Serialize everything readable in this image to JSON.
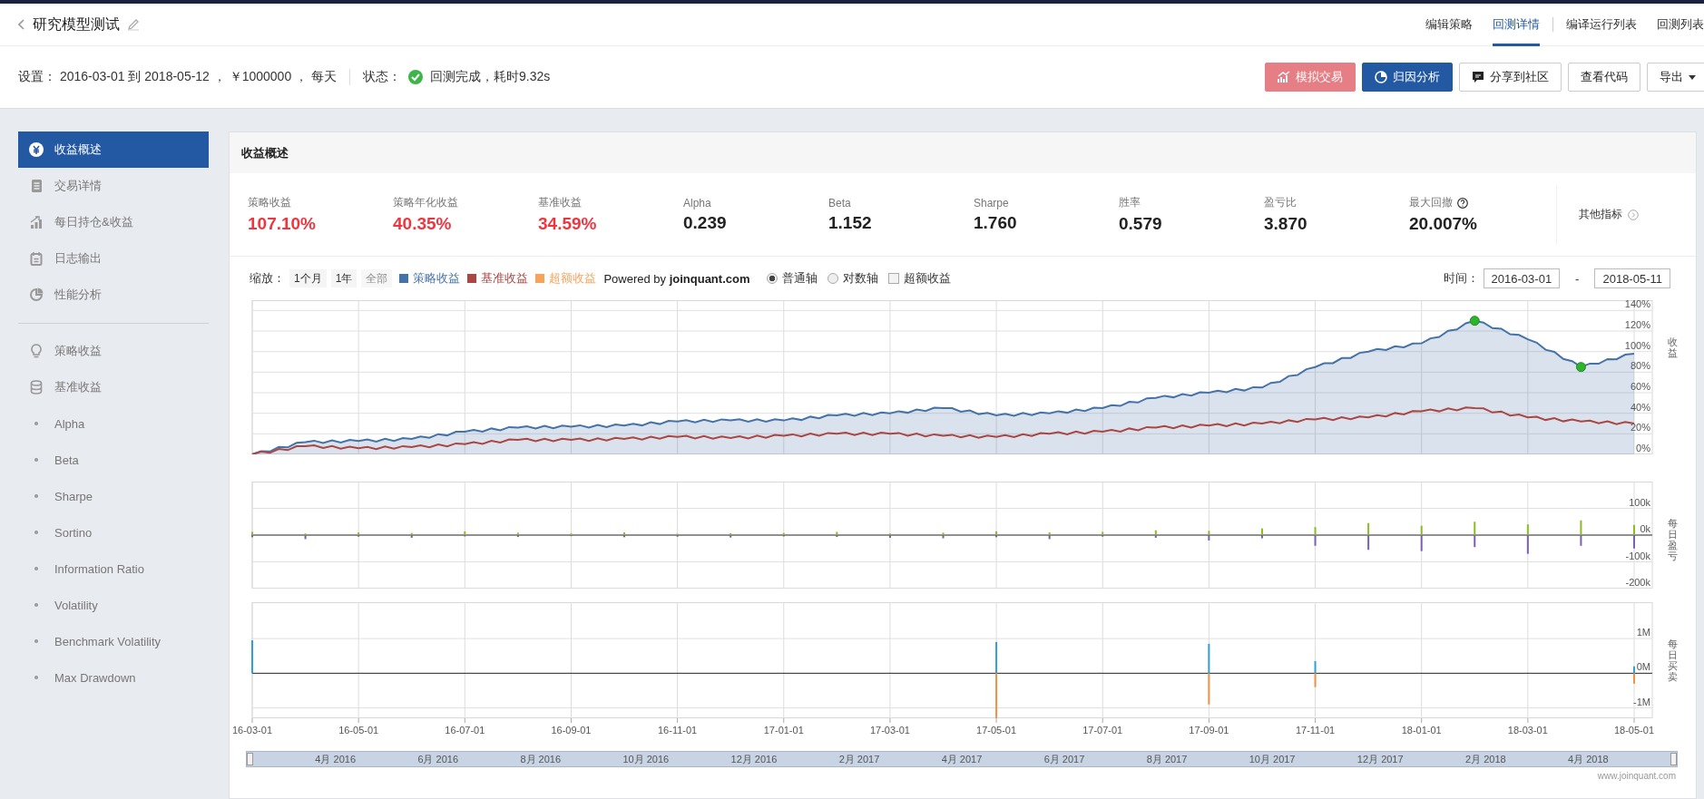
{
  "header": {
    "title": "研究模型测试",
    "tabs": [
      {
        "label": "编辑策略",
        "selected": false
      },
      {
        "label": "回测详情",
        "selected": true
      },
      {
        "label": "编译运行列表",
        "selected": false
      },
      {
        "label": "回测列表",
        "selected": false
      }
    ]
  },
  "settings": {
    "text": "设置： 2016-03-01 到 2018-05-12 ， ￥1000000 ， 每天",
    "status_label": "状态：",
    "status": "回测完成，耗时9.32s",
    "done": true
  },
  "buttons": [
    {
      "label": "模拟交易",
      "kind": "trade",
      "disabled": true
    },
    {
      "label": "归因分析",
      "kind": "attribution",
      "disabled": false
    },
    {
      "label": "分享到社区",
      "kind": "share",
      "disabled": false
    },
    {
      "label": "查看代码",
      "kind": "plain",
      "disabled": false
    },
    {
      "label": "导出",
      "kind": "dropdown",
      "disabled": false
    }
  ],
  "sidebar": {
    "groups": [
      [
        {
          "label": "收益概述",
          "kind": "overview",
          "selected": true
        },
        {
          "label": "交易详情",
          "kind": "trades",
          "selected": false
        },
        {
          "label": "每日持仓&收益",
          "kind": "holdings",
          "selected": false
        },
        {
          "label": "日志输出",
          "kind": "log",
          "selected": false
        },
        {
          "label": "性能分析",
          "kind": "performance",
          "selected": false
        }
      ],
      [
        {
          "label": "策略收益",
          "kind": "strategy",
          "selected": false
        },
        {
          "label": "基准收益",
          "kind": "benchmark",
          "selected": false
        },
        {
          "label": "Alpha",
          "kind": "metric",
          "selected": false
        },
        {
          "label": "Beta",
          "kind": "metric",
          "selected": false
        },
        {
          "label": "Sharpe",
          "kind": "metric",
          "selected": false
        },
        {
          "label": "Sortino",
          "kind": "metric",
          "selected": false
        },
        {
          "label": "Information Ratio",
          "kind": "metric",
          "selected": false
        },
        {
          "label": "Volatility",
          "kind": "metric",
          "selected": false
        },
        {
          "label": "Benchmark Volatility",
          "kind": "metric",
          "selected": false
        },
        {
          "label": "Max Drawdown",
          "kind": "metric",
          "selected": false
        }
      ]
    ]
  },
  "panel": {
    "title": "收益概述",
    "metrics": [
      {
        "label": "策略收益",
        "value": "107.10%",
        "color": "#f0353f",
        "help": false
      },
      {
        "label": "策略年化收益",
        "value": "40.35%",
        "color": "#f0353f",
        "help": false
      },
      {
        "label": "基准收益",
        "value": "34.59%",
        "color": "#f0353f",
        "help": false
      },
      {
        "label": "Alpha",
        "value": "0.239",
        "color": "#222222",
        "help": false
      },
      {
        "label": "Beta",
        "value": "1.152",
        "color": "#222222",
        "help": false
      },
      {
        "label": "Sharpe",
        "value": "1.760",
        "color": "#222222",
        "help": false
      },
      {
        "label": "胜率",
        "value": "0.579",
        "color": "#222222",
        "help": false
      },
      {
        "label": "盈亏比",
        "value": "3.870",
        "color": "#222222",
        "help": false
      },
      {
        "label": "最大回撤",
        "value": "20.007%",
        "color": "#222222",
        "help": true
      }
    ],
    "more": "其他指标"
  },
  "controls": {
    "zoom_label": "缩放：",
    "zoom": [
      {
        "label": "1个月",
        "selected": false
      },
      {
        "label": "1年",
        "selected": false
      },
      {
        "label": "全部",
        "selected": true
      }
    ],
    "extra_legend": {
      "label": "超额收益",
      "color": "#f7a35c"
    },
    "powered": "Powered by **joinquant.com**",
    "axis_modes": [
      {
        "label": "普通轴",
        "selected": true
      },
      {
        "label": "对数轴",
        "selected": false
      }
    ],
    "excess": {
      "label": "超额收益",
      "checked": false
    },
    "time_label": "时间：",
    "from": "2016-03-01",
    "separator": "-",
    "to": "2018-05-11"
  },
  "charts": [
    {
      "chart_data": {
        "type": "line",
        "ylabel": "收益",
        "grid": true,
        "legend": "top",
        "ylim": [
          0,
          150
        ],
        "yticks": [
          {
            "value": 0,
            "label": "0%"
          },
          {
            "value": 20,
            "label": "20%"
          },
          {
            "value": 40,
            "label": "40%"
          },
          {
            "value": 60,
            "label": "60%"
          },
          {
            "value": 80,
            "label": "80%"
          },
          {
            "value": 100,
            "label": "100%"
          },
          {
            "value": 120,
            "label": "120%"
          },
          {
            "value": 140,
            "label": "140%"
          }
        ],
        "series": [
          {
            "name": "策略收益",
            "color": "#4572a7",
            "values": [
              0,
              12,
              13,
              15,
              22,
              26,
              27,
              28,
              32,
              33,
              33,
              38,
              40,
              45,
              38,
              40,
              45,
              55,
              60,
              65,
              85,
              100,
              108,
              130,
              112,
              85,
              98
            ]
          },
          {
            "name": "基准收益",
            "color": "#aa4643",
            "values": [
              0,
              8,
              6,
              7,
              10,
              14,
              14,
              15,
              17,
              16,
              18,
              20,
              20,
              18,
              17,
              20,
              22,
              26,
              28,
              30,
              34,
              36,
              42,
              45,
              36,
              32,
              30
            ]
          }
        ]
      }
    },
    {
      "chart_data": {
        "type": "bar",
        "ylabel": "每日盈亏",
        "grid": true,
        "stacked": true,
        "ylim": [
          -200000,
          200000
        ],
        "yticks": [
          {
            "value": 100000,
            "label": "100k"
          },
          {
            "value": 0,
            "label": "0k"
          },
          {
            "value": -100000,
            "label": "-100k"
          },
          {
            "value": -200000,
            "label": "-200k"
          }
        ],
        "series": [
          {
            "color": "#8bbc21",
            "values": [
              12000,
              6000,
              10000,
              8000,
              14000,
              9000,
              6000,
              10000,
              5000,
              7000,
              8000,
              12000,
              6000,
              9000,
              14000,
              10000,
              12000,
              18000,
              16000,
              25000,
              30000,
              45000,
              35000,
              50000,
              40000,
              55000,
              38000
            ]
          },
          {
            "color": "#7b5fb5",
            "values": [
              -8000,
              -15000,
              -6000,
              -10000,
              -5000,
              -7000,
              -4000,
              -8000,
              -6000,
              -9000,
              -5000,
              -7000,
              -10000,
              -12000,
              -8000,
              -15000,
              -6000,
              -10000,
              -20000,
              -12000,
              -40000,
              -55000,
              -60000,
              -45000,
              -70000,
              -40000,
              -50000
            ]
          }
        ]
      }
    },
    {
      "chart_data": {
        "type": "bar",
        "ylabel": "每日买卖",
        "grid": true,
        "stacked": true,
        "categories": [
          "16-03-01",
          null,
          "16-05-01",
          null,
          "16-07-01",
          null,
          "16-09-01",
          null,
          "16-11-01",
          null,
          "17-01-01",
          null,
          "17-03-01",
          null,
          "17-05-01",
          null,
          "17-07-01",
          null,
          "17-09-01",
          null,
          "17-11-01",
          null,
          "18-01-01",
          null,
          "18-03-01",
          null,
          "18-05-01"
        ],
        "ylim": [
          -1300000,
          2050000
        ],
        "yticks": [
          {
            "value": 1000000,
            "label": "1M"
          },
          {
            "value": 0,
            "label": "0M"
          },
          {
            "value": -1000000,
            "label": "-1M"
          }
        ],
        "series": [
          {
            "color": "#2f9fd8",
            "values": [
              950000,
              0,
              0,
              0,
              0,
              0,
              0,
              0,
              0,
              0,
              0,
              0,
              0,
              0,
              900000,
              0,
              0,
              0,
              850000,
              0,
              350000,
              0,
              0,
              0,
              0,
              0,
              200000
            ]
          },
          {
            "color": "#f28f43",
            "values": [
              0,
              0,
              0,
              0,
              0,
              0,
              0,
              0,
              0,
              0,
              0,
              0,
              0,
              0,
              -1300000,
              0,
              0,
              0,
              -900000,
              0,
              -400000,
              0,
              0,
              0,
              0,
              0,
              -300000
            ]
          }
        ]
      }
    }
  ],
  "navigator": {
    "labels": [
      "4月 2016",
      "6月 2016",
      "8月 2016",
      "10月 2016",
      "12月 2016",
      "2月 2017",
      "4月 2017",
      "6月 2017",
      "8月 2017",
      "10月 2017",
      "12月 2017",
      "2月 2018",
      "4月 2018"
    ]
  },
  "credits": "www.joinquant.com"
}
